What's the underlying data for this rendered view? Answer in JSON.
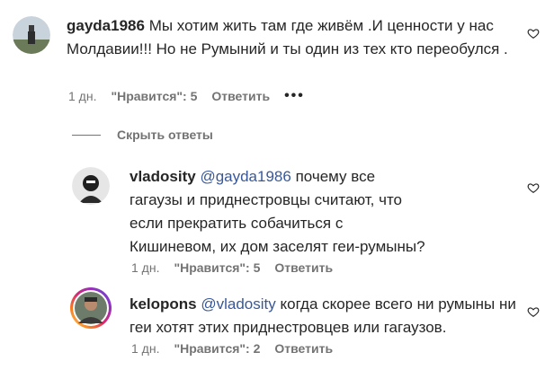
{
  "comments": [
    {
      "username": "gayda1986",
      "text": "Мы хотим жить там где живём .И ценности у нас Молдавии!!! Но не Румыний и ты один из тех кто переобулся .",
      "mention": "",
      "time": "1 дн.",
      "likes": "\"Нравится\": 5",
      "reply": "Ответить",
      "more": "•••"
    },
    {
      "username": "vladosity",
      "mention": "@gayda1986",
      "text": "почему все гагаузы и приднестровцы считают, что если прекратить собачиться с Кишиневом, их дом заселят геи-румыны?",
      "time": "1 дн.",
      "likes": "\"Нравится\": 5",
      "reply": "Ответить"
    },
    {
      "username": "kelopons",
      "mention": "@vladosity",
      "text": "когда скорее всего ни румыны ни геи хотят этих приднестровцев или гагаузов.",
      "time": "1 дн.",
      "likes": "\"Нравится\": 2",
      "reply": "Ответить"
    }
  ],
  "hide_replies": "Скрыть ответы",
  "icons": {
    "like": "heart-outline-icon",
    "more": "more-dots-icon"
  },
  "colors": {
    "mention": "#385898",
    "muted": "#737373",
    "text": "#262626"
  }
}
